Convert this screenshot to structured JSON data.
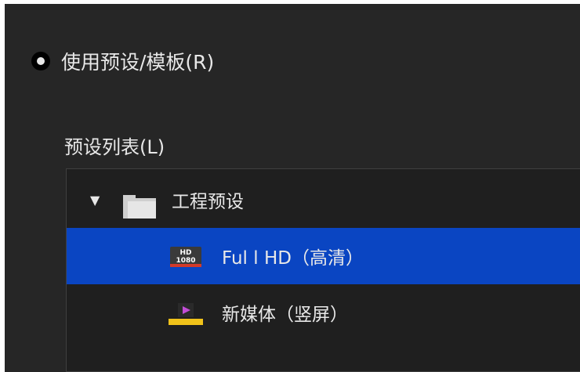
{
  "option": {
    "label": "使用预设/模板(R)",
    "selected": true
  },
  "preset_list": {
    "label": "预设列表(L)",
    "folder": {
      "name": "工程预设",
      "expanded": true,
      "icon": "folder-icon"
    },
    "items": [
      {
        "name": "Ful l HD（高清）",
        "icon": "hd-1080-icon",
        "icon_text_top": "HD",
        "icon_text_bottom": "1080",
        "selected": true
      },
      {
        "name": "新媒体（竖屏）",
        "icon": "vertical-media-icon",
        "selected": false
      }
    ]
  },
  "colors": {
    "background": "#262626",
    "selection": "#0a45c2",
    "text": "#e8e8e8"
  }
}
